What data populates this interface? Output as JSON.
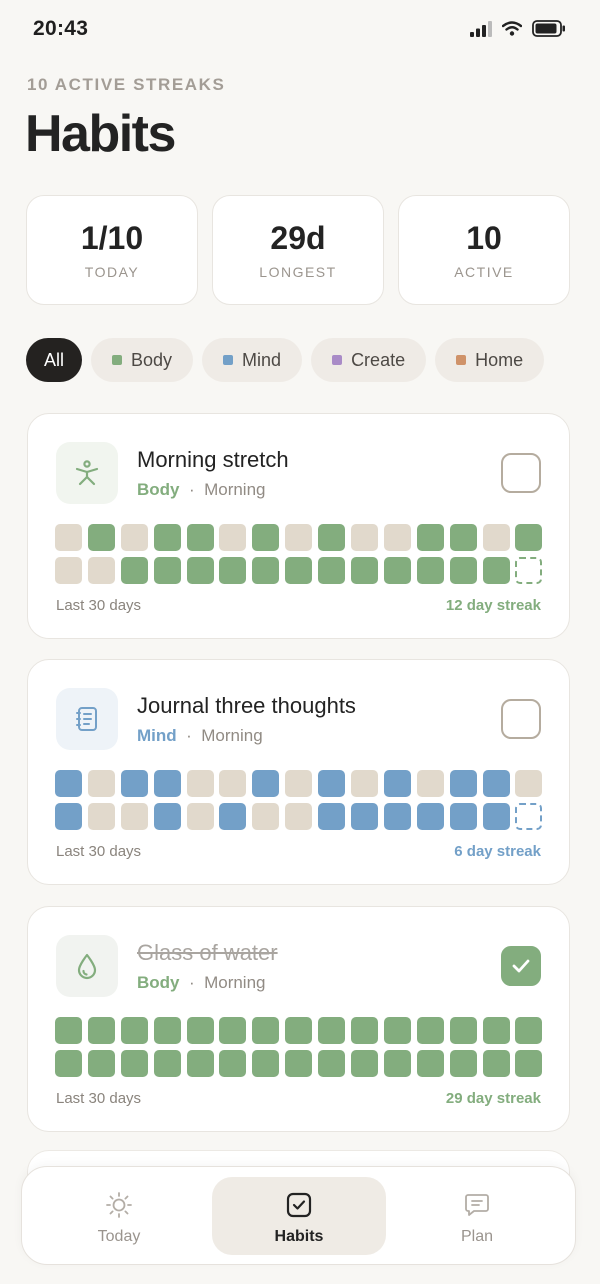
{
  "status": {
    "time": "20:43"
  },
  "header": {
    "subtitle": "10 ACTIVE STREAKS",
    "title": "Habits"
  },
  "stats": [
    {
      "value": "1/10",
      "label": "TODAY"
    },
    {
      "value": "29d",
      "label": "LONGEST"
    },
    {
      "value": "10",
      "label": "ACTIVE"
    }
  ],
  "filters": [
    {
      "label": "All",
      "color": ""
    },
    {
      "label": "Body",
      "color": "#83ad7e"
    },
    {
      "label": "Mind",
      "color": "#73a0c8"
    },
    {
      "label": "Create",
      "color": "#a98bc7"
    },
    {
      "label": "Home",
      "color": "#cf9269"
    }
  ],
  "colors": {
    "empty_cell": "#e1d9cc",
    "body": "#83ad7e",
    "mind": "#73a0c8"
  },
  "habits": [
    {
      "name": "Morning stretch",
      "category": "Body",
      "time": "Morning",
      "icon": "stretch-figure-icon",
      "color": "#83ad7e",
      "icon_bg": "#f1f5ef",
      "checked": false,
      "history": [
        0,
        1,
        0,
        1,
        1,
        0,
        1,
        0,
        1,
        0,
        0,
        1,
        1,
        0,
        1,
        0,
        0,
        1,
        1,
        1,
        1,
        1,
        1,
        1,
        1,
        1,
        1,
        1,
        1,
        2
      ],
      "footer_left": "Last 30 days",
      "streak": "12 day streak"
    },
    {
      "name": "Journal three thoughts",
      "category": "Mind",
      "time": "Morning",
      "icon": "journal-icon",
      "color": "#73a0c8",
      "icon_bg": "#eef3f8",
      "checked": false,
      "history": [
        1,
        0,
        1,
        1,
        0,
        0,
        1,
        0,
        1,
        0,
        1,
        0,
        1,
        1,
        0,
        1,
        0,
        0,
        1,
        0,
        1,
        0,
        0,
        1,
        1,
        1,
        1,
        1,
        1,
        2
      ],
      "footer_left": "Last 30 days",
      "streak": "6 day streak"
    },
    {
      "name": "Glass of water",
      "category": "Body",
      "time": "Morning",
      "icon": "water-drop-icon",
      "color": "#83ad7e",
      "icon_bg": "#f1f5ef",
      "checked": true,
      "history": [
        1,
        1,
        1,
        1,
        1,
        1,
        1,
        1,
        1,
        1,
        1,
        1,
        1,
        1,
        1,
        1,
        1,
        1,
        1,
        1,
        1,
        1,
        1,
        1,
        1,
        1,
        1,
        1,
        1,
        1
      ],
      "footer_left": "Last 30 days",
      "streak": "29 day streak"
    }
  ],
  "tabs": [
    {
      "label": "Today",
      "icon": "sun-icon",
      "active": false
    },
    {
      "label": "Habits",
      "icon": "checkbox-icon",
      "active": true
    },
    {
      "label": "Plan",
      "icon": "chat-bubble-icon",
      "active": false
    }
  ]
}
